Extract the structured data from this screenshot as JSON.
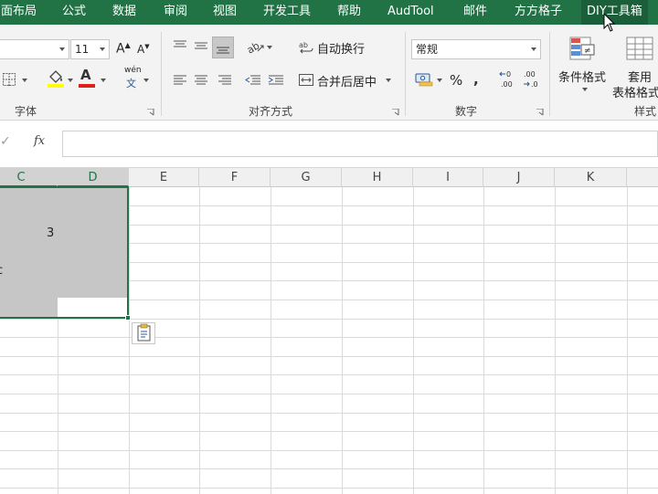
{
  "tabs": [
    {
      "label": "面布局"
    },
    {
      "label": "公式"
    },
    {
      "label": "数据"
    },
    {
      "label": "审阅"
    },
    {
      "label": "视图"
    },
    {
      "label": "开发工具"
    },
    {
      "label": "帮助"
    },
    {
      "label": "AudTool"
    },
    {
      "label": "邮件"
    },
    {
      "label": "方方格子"
    },
    {
      "label": "DIY工具箱"
    }
  ],
  "font_group": {
    "size_value": "11",
    "increase_label": "A",
    "decrease_label": "A",
    "phonetic_top": "wén",
    "phonetic_bottom": "文",
    "font_color_letter": "A",
    "group_label": "字体"
  },
  "align_group": {
    "wrap_label": "自动换行",
    "merge_label": "合并后居中",
    "group_label": "对齐方式"
  },
  "number_group": {
    "format_value": "常规",
    "percent_label": "%",
    "group_label": "数字"
  },
  "styles_group": {
    "cond_format_label": "条件格式",
    "table_format_line1": "套用",
    "table_format_line2": "表格格式",
    "group_label": "样式"
  },
  "formula_bar": {
    "fx_label": "fx",
    "check_label": "✓",
    "value": ""
  },
  "columns": [
    "C",
    "D",
    "E",
    "F",
    "G",
    "H",
    "I",
    "J",
    "K"
  ],
  "cells": {
    "c3_value": "3",
    "partial_text": "c"
  },
  "colors": {
    "accent": "#217346",
    "selection_fill": "#c6c6c6",
    "font_color_bar": "#e0201b",
    "fill_color_bar": "#ffff00"
  },
  "icons": [
    "check-icon",
    "fx-icon",
    "wrap-text-icon",
    "merge-center-icon",
    "paste-options-icon",
    "mouse-cursor-icon"
  ]
}
